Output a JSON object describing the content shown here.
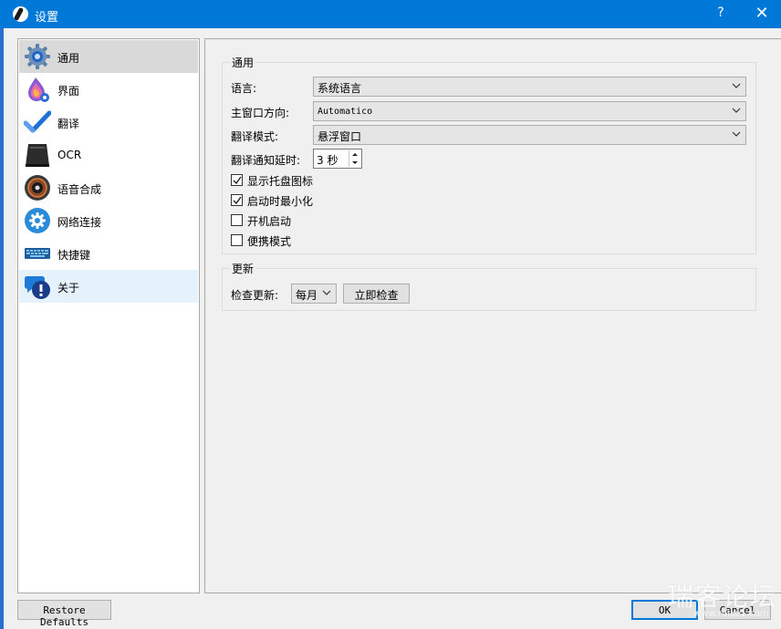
{
  "window": {
    "title": "设置",
    "help_glyph": "?",
    "close_glyph": "✕"
  },
  "sidebar": {
    "items": [
      {
        "label": "通用",
        "icon": "gear-icon"
      },
      {
        "label": "界面",
        "icon": "palette-icon"
      },
      {
        "label": "翻译",
        "icon": "checkmark-icon"
      },
      {
        "label": "OCR",
        "icon": "scanner-icon"
      },
      {
        "label": "语音合成",
        "icon": "speaker-icon"
      },
      {
        "label": "网络连接",
        "icon": "network-gear-icon"
      },
      {
        "label": "快捷键",
        "icon": "keyboard-icon"
      },
      {
        "label": "关于",
        "icon": "info-chat-icon"
      }
    ],
    "selected": "通用"
  },
  "general": {
    "group_title": "通用",
    "language_label": "语言:",
    "language_value": "系统语言",
    "window_direction_label": "主窗口方向:",
    "window_direction_value": "Automatico",
    "translation_mode_label": "翻译模式:",
    "translation_mode_value": "悬浮窗口",
    "notify_delay_label": "翻译通知延时:",
    "notify_delay_value": "3 秒",
    "checkboxes": [
      {
        "label": "显示托盘图标",
        "checked": true
      },
      {
        "label": "启动时最小化",
        "checked": true
      },
      {
        "label": "开机启动",
        "checked": false
      },
      {
        "label": "便携模式",
        "checked": false
      }
    ]
  },
  "update": {
    "group_title": "更新",
    "check_label": "检查更新:",
    "frequency_value": "每月",
    "check_now_button": "立即检查"
  },
  "footer": {
    "restore_defaults": "Restore Defaults",
    "ok": "OK",
    "cancel": "Cancel"
  },
  "watermark": {
    "text": "瑞客论坛",
    "sub": "www.ruike1.com"
  },
  "colors": {
    "titlebar": "#0078d7",
    "selected_item": "#d9d9d9",
    "hover_item": "#e5f1fb",
    "default_button_border": "#0078d7"
  }
}
